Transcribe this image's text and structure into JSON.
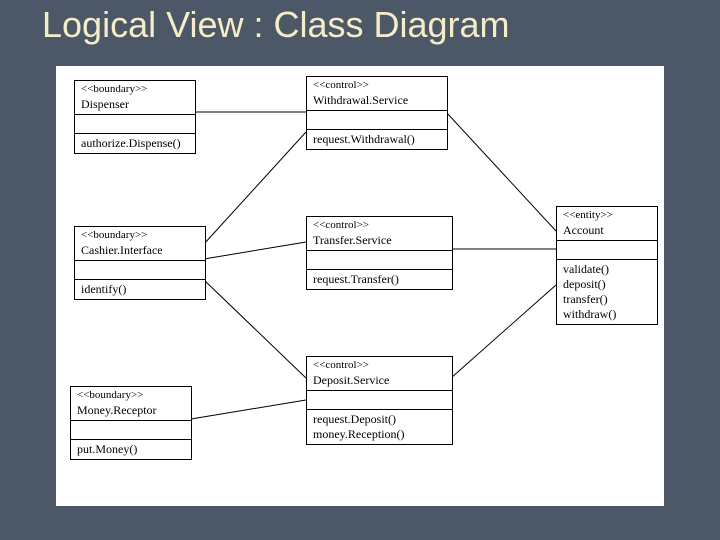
{
  "title": "Logical View : Class Diagram",
  "classes": {
    "dispenser": {
      "stereo": "<<boundary>>",
      "name": "Dispenser",
      "ops": [
        "authorize.Dispense()"
      ]
    },
    "withdrawal": {
      "stereo": "<<control>>",
      "name": "Withdrawal.Service",
      "ops": [
        "request.Withdrawal()"
      ]
    },
    "cashier": {
      "stereo": "<<boundary>>",
      "name": "Cashier.Interface",
      "ops": [
        "identify()"
      ]
    },
    "transfer": {
      "stereo": "<<control>>",
      "name": "Transfer.Service",
      "ops": [
        "request.Transfer()"
      ]
    },
    "account": {
      "stereo": "<<entity>>",
      "name": "Account",
      "ops": [
        "validate()",
        "deposit()",
        "transfer()",
        "withdraw()"
      ]
    },
    "deposit": {
      "stereo": "<<control>>",
      "name": "Deposit.Service",
      "ops": [
        "request.Deposit()",
        "money.Reception()"
      ]
    },
    "receptor": {
      "stereo": "<<boundary>>",
      "name": "Money.Receptor",
      "ops": [
        "put.Money()"
      ]
    }
  }
}
